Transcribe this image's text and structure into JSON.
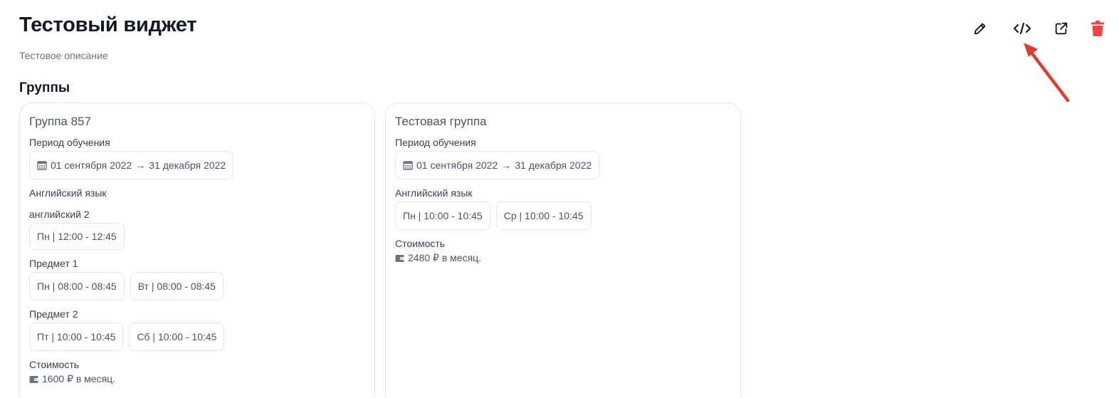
{
  "header": {
    "title": "Тестовый виджет",
    "description": "Тестовое описание",
    "actions": [
      {
        "name": "edit",
        "icon": "pencil-icon"
      },
      {
        "name": "embed-code",
        "icon": "code-icon"
      },
      {
        "name": "open-external",
        "icon": "external-link-icon"
      },
      {
        "name": "delete",
        "icon": "trash-icon",
        "color": "#ef4444"
      }
    ]
  },
  "groups_section": {
    "title": "Группы"
  },
  "groups": [
    {
      "name": "Группа 857",
      "period_label": "Период обучения",
      "period_start": "01 сентября 2022",
      "period_arrow": "→",
      "period_end": "31 декабря 2022",
      "subjects": [
        {
          "name": "Английский язык",
          "slots": []
        },
        {
          "name": "английский 2",
          "slots": [
            "Пн | 12:00 - 12:45"
          ]
        },
        {
          "name": "Предмет 1",
          "slots": [
            "Пн | 08:00 - 08:45",
            "Вт | 08:00 - 08:45"
          ]
        },
        {
          "name": "Предмет 2",
          "slots": [
            "Пт | 10:00 - 10:45",
            "Сб | 10:00 - 10:45"
          ]
        }
      ],
      "cost_label": "Стоимость",
      "cost_value": "1600 ₽ в месяц."
    },
    {
      "name": "Тестовая группа",
      "period_label": "Период обучения",
      "period_start": "01 сентября 2022",
      "period_arrow": "→",
      "period_end": "31 декабря 2022",
      "subjects": [
        {
          "name": "Английский язык",
          "slots": [
            "Пн | 10:00 - 10:45",
            "Ср | 10:00 - 10:45"
          ]
        }
      ],
      "cost_label": "Стоимость",
      "cost_value": "2480 ₽ в месяц."
    }
  ],
  "colors": {
    "accent_danger": "#ef4444",
    "annotation_arrow": "#e03b2f",
    "border": "#e5e7eb"
  }
}
